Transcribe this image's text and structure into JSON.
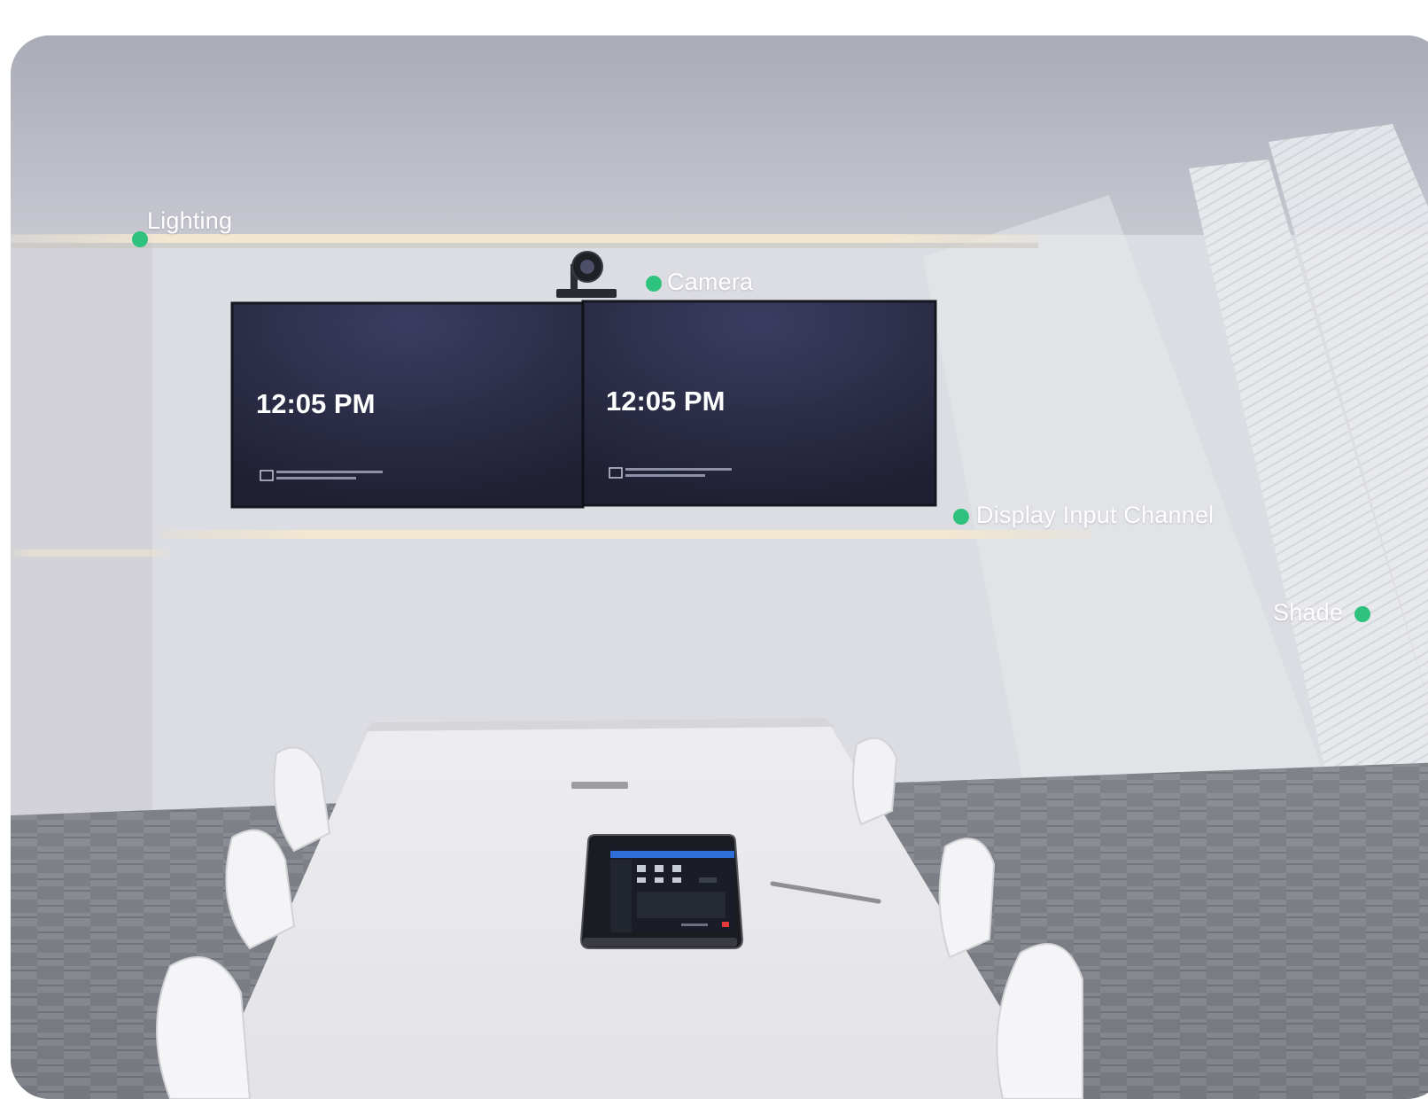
{
  "hotspots": {
    "lighting": "Lighting",
    "camera": "Camera",
    "display_input_channel": "Display Input Channel",
    "shade": "Shade"
  },
  "displays": {
    "left_time": "12:05 PM",
    "right_time": "12:05 PM"
  },
  "colors": {
    "hotspot_dot": "#2ec27e",
    "label_text": "#ffffff",
    "display_background": "#22233a"
  }
}
